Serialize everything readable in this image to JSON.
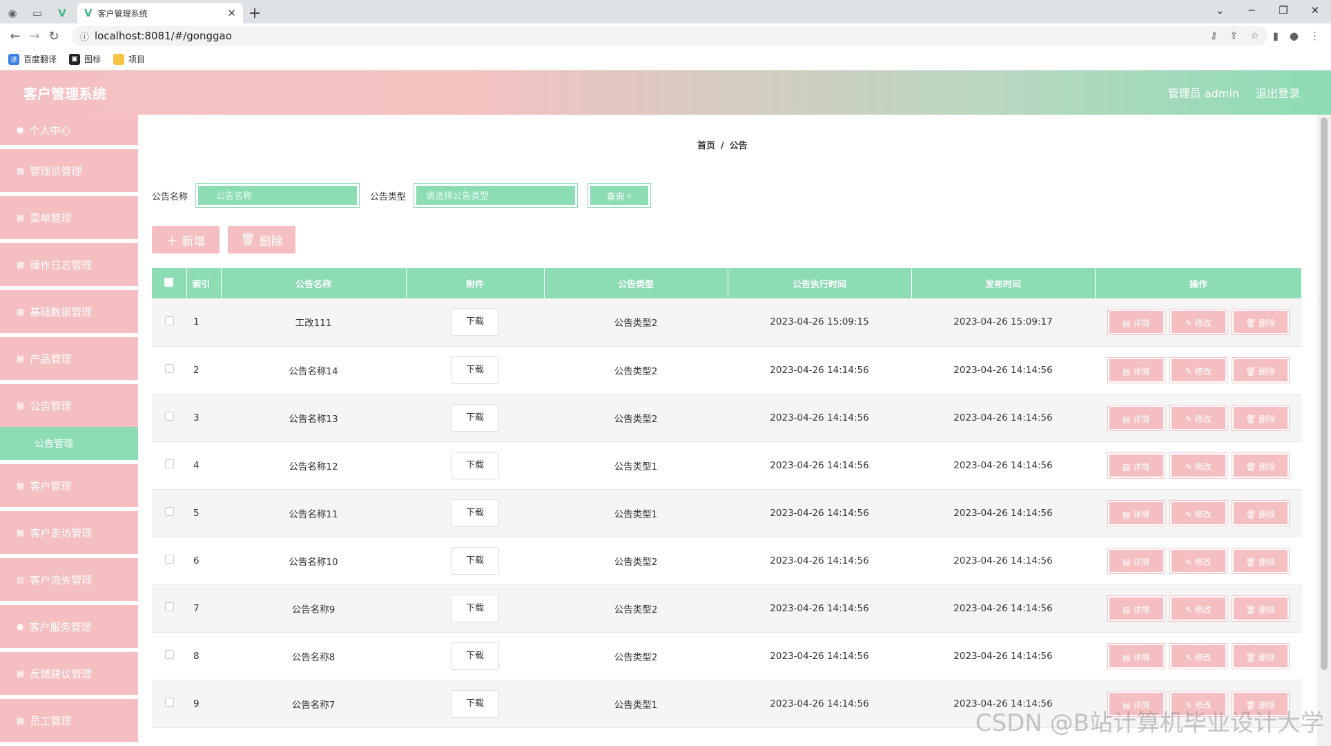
{
  "browser": {
    "tab_title": "客户管理系统",
    "url": "localhost:8081/#/gonggao",
    "bookmarks": [
      "百度翻译",
      "图标",
      "项目"
    ]
  },
  "header": {
    "title": "客户管理系统",
    "user": "管理员 admin",
    "logout": "退出登录"
  },
  "sidebar": {
    "items": [
      "个人中心",
      "管理员管理",
      "菜单管理",
      "操作日志管理",
      "基础数据管理",
      "产品管理",
      "公告管理",
      "客户管理",
      "客户走访管理",
      "客户流失管理",
      "客户服务管理",
      "反馈建议管理",
      "员工管理"
    ],
    "active_sub": "公告管理"
  },
  "breadcrumb": {
    "home": "首页",
    "sep": "/",
    "current": "公告"
  },
  "search": {
    "name_label": "公告名称",
    "name_placeholder": "公告名称",
    "type_label": "公告类型",
    "type_placeholder": "请选择公告类型",
    "query_button": "查询"
  },
  "actions": {
    "add": "新增",
    "delete": "删除"
  },
  "table": {
    "headers": [
      "索引",
      "公告名称",
      "附件",
      "公告类型",
      "公告执行时间",
      "发布时间",
      "操作"
    ],
    "download_label": "下载",
    "op_labels": {
      "detail": "详情",
      "edit": "修改",
      "delete": "删除"
    },
    "rows": [
      [
        "1",
        "工改111",
        "公告类型2",
        "2023-04-26 15:09:15",
        "2023-04-26 15:09:17"
      ],
      [
        "2",
        "公告名称14",
        "公告类型2",
        "2023-04-26 14:14:56",
        "2023-04-26 14:14:56"
      ],
      [
        "3",
        "公告名称13",
        "公告类型2",
        "2023-04-26 14:14:56",
        "2023-04-26 14:14:56"
      ],
      [
        "4",
        "公告名称12",
        "公告类型1",
        "2023-04-26 14:14:56",
        "2023-04-26 14:14:56"
      ],
      [
        "5",
        "公告名称11",
        "公告类型1",
        "2023-04-26 14:14:56",
        "2023-04-26 14:14:56"
      ],
      [
        "6",
        "公告名称10",
        "公告类型2",
        "2023-04-26 14:14:56",
        "2023-04-26 14:14:56"
      ],
      [
        "7",
        "公告名称9",
        "公告类型2",
        "2023-04-26 14:14:56",
        "2023-04-26 14:14:56"
      ],
      [
        "8",
        "公告名称8",
        "公告类型2",
        "2023-04-26 14:14:56",
        "2023-04-26 14:14:56"
      ],
      [
        "9",
        "公告名称7",
        "公告类型1",
        "2023-04-26 14:14:56",
        "2023-04-26 14:14:56"
      ]
    ]
  },
  "watermark": "CSDN @B站计算机毕业设计大学",
  "colors": {
    "pink": "#f5bfc1",
    "green": "#8cdcb4"
  }
}
